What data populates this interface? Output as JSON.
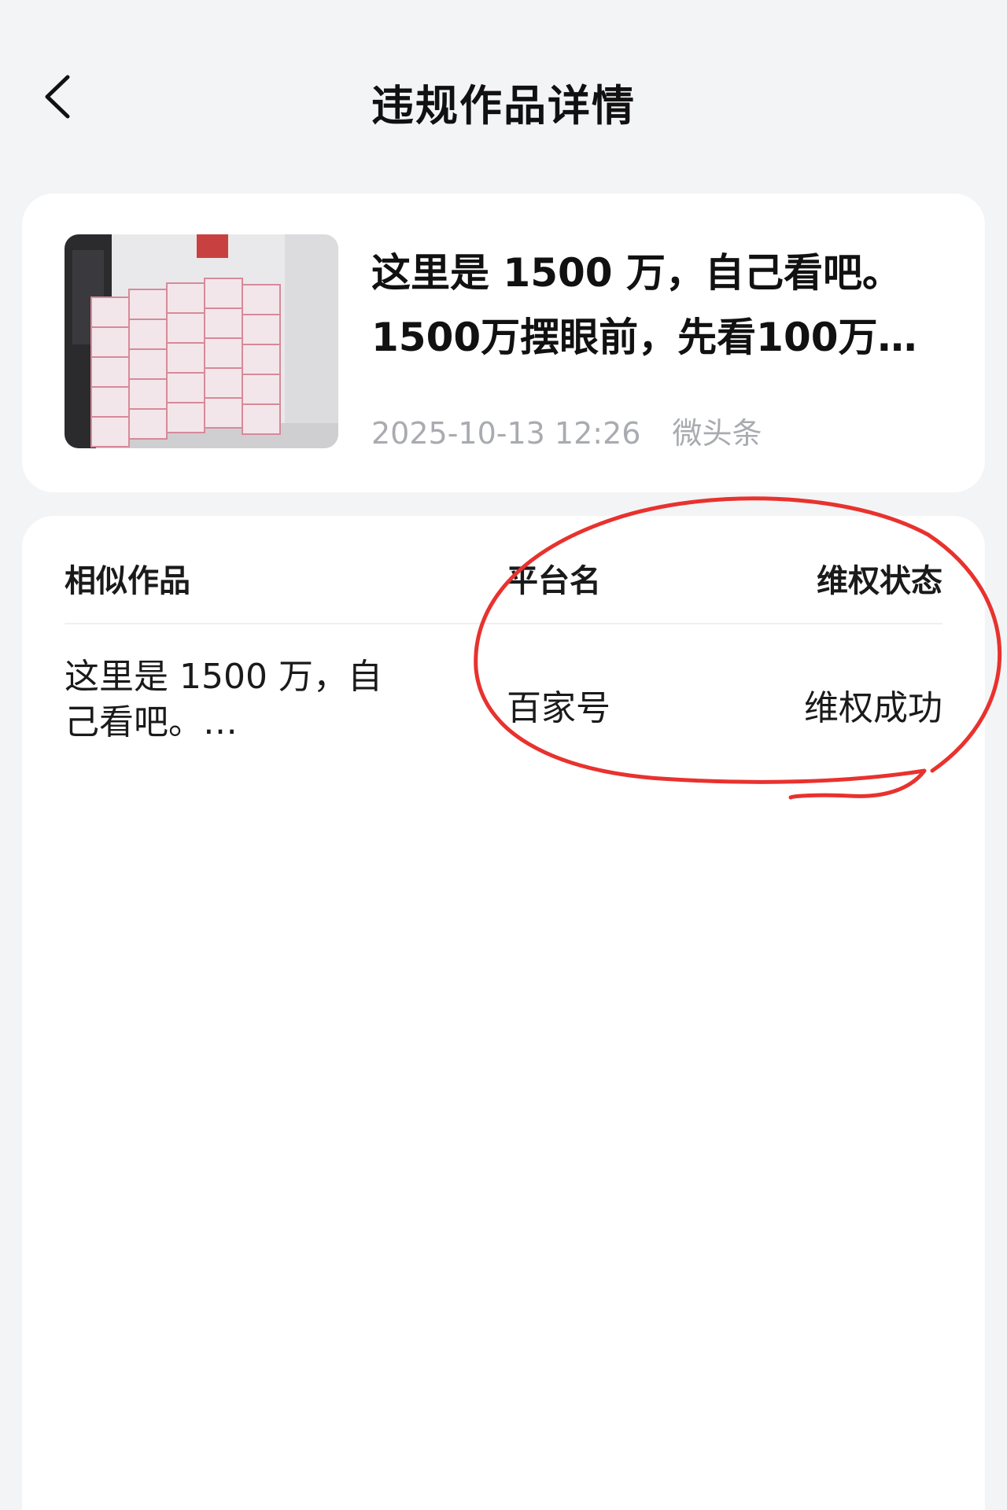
{
  "header": {
    "title": "违规作品详情",
    "back_icon": "chevron-left-icon"
  },
  "work": {
    "thumbnail": "stacks-of-cash-photo",
    "title": "这里是 1500 万，自己看吧。1500万摆眼前，先看100万…",
    "date": "2025-10-13 12:26",
    "source": "微头条"
  },
  "similar": {
    "columns": {
      "work": "相似作品",
      "platform": "平台名",
      "status": "维权状态"
    },
    "rows": [
      {
        "work": "这里是 1500 万，自己看吧。…",
        "platform": "百家号",
        "status": "维权成功"
      }
    ]
  },
  "annotation": {
    "color": "#e8322e"
  },
  "colors": {
    "background": "#f3f4f6",
    "card": "#ffffff",
    "meta_text": "#a9abb0"
  }
}
